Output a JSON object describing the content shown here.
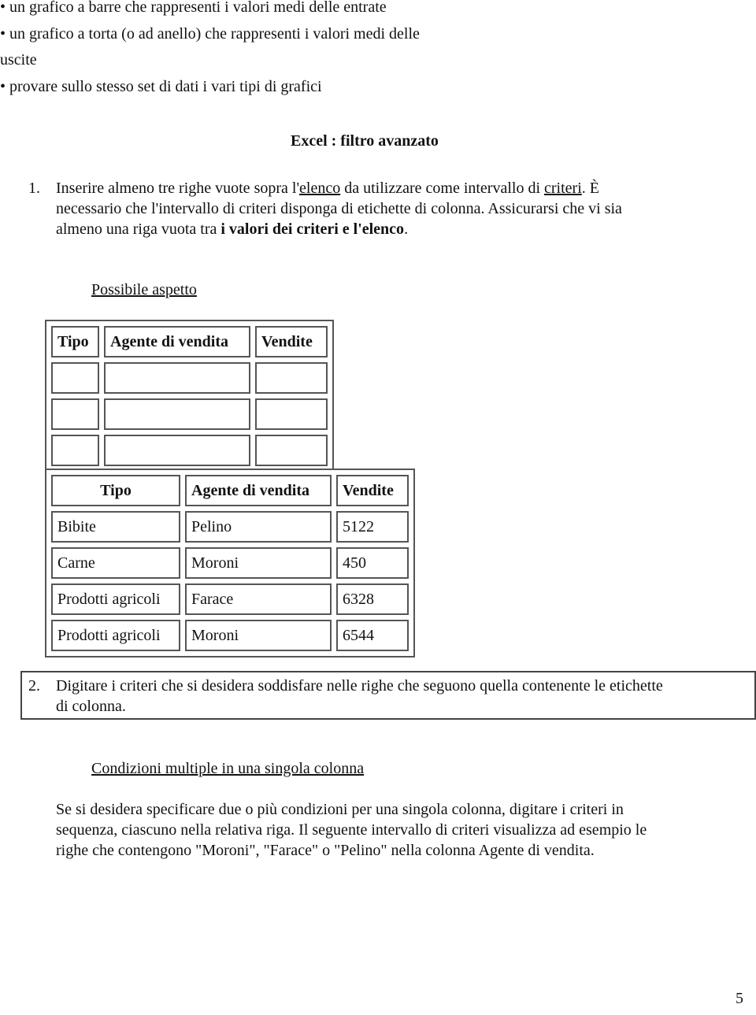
{
  "bullets": [
    "• un grafico a barre che rappresenti i valori medi delle entrate",
    "• un grafico a torta (o ad anello) che rappresenti i valori medi delle",
    "uscite",
    "• provare sullo stesso set di dati i vari tipi di grafici"
  ],
  "section_title": "Excel : filtro avanzato",
  "step1": {
    "number": "1.",
    "line1_a": "Inserire almeno tre righe vuote sopra l'",
    "line1_link1": "elenco",
    "line1_b": " da utilizzare come intervallo di ",
    "line1_link2": "criteri",
    "line1_c": ". È",
    "line2": "necessario che l'intervallo di criteri disponga di etichette di colonna. Assicurarsi che vi sia",
    "line3_a": "almeno una riga vuota tra ",
    "line3_bold": "i valori dei criteri e l'elenco",
    "line3_c": "."
  },
  "possible_aspect_label": "Possibile aspetto",
  "criteria_table": {
    "headers": [
      "Tipo",
      "Agente di vendita",
      "Vendite"
    ],
    "rows": [
      [
        "",
        "",
        ""
      ],
      [
        "",
        "",
        ""
      ],
      [
        "",
        "",
        ""
      ]
    ]
  },
  "list_table": {
    "headers": [
      "Tipo",
      "Agente di vendita",
      "Vendite"
    ],
    "rows": [
      [
        "Bibite",
        "Pelino",
        "5122"
      ],
      [
        "Carne",
        "Moroni",
        "450"
      ],
      [
        "Prodotti agricoli",
        "Farace",
        "6328"
      ],
      [
        "Prodotti agricoli",
        "Moroni",
        "6544"
      ]
    ]
  },
  "step2": {
    "number": "2.",
    "line1": "Digitare i criteri che si desidera soddisfare nelle righe che seguono quella contenente le etichette",
    "line2": "di colonna."
  },
  "subsection_title": "Condizioni multiple in una singola colonna",
  "paragraph": [
    "Se si desidera specificare due o più condizioni per una singola colonna, digitare i criteri in",
    "sequenza, ciascuno nella relativa riga. Il seguente intervallo di criteri visualizza ad esempio le",
    "righe che contengono \"Moroni\", \"Farace\" o \"Pelino\" nella colonna Agente di vendita."
  ],
  "page_number": "5"
}
